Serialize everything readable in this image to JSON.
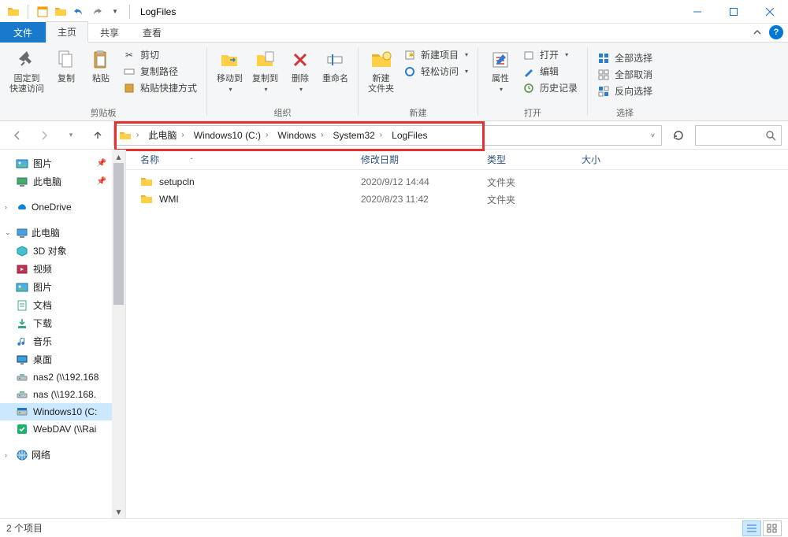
{
  "window": {
    "title": "LogFiles"
  },
  "tabs": {
    "file": "文件",
    "home": "主页",
    "share": "共享",
    "view": "查看"
  },
  "ribbon": {
    "pin": "固定到\n快速访问",
    "copy": "复制",
    "paste": "粘贴",
    "cut": "剪切",
    "copypath": "复制路径",
    "pasteshortcut": "粘贴快捷方式",
    "clipboard_group": "剪贴板",
    "moveto": "移动到",
    "copyto": "复制到",
    "delete": "删除",
    "rename": "重命名",
    "org_group": "组织",
    "newfolder": "新建\n文件夹",
    "newitem": "新建项目",
    "easyaccess": "轻松访问",
    "new_group": "新建",
    "properties": "属性",
    "open": "打开",
    "edit": "编辑",
    "history": "历史记录",
    "open_group": "打开",
    "selectall": "全部选择",
    "selectnone": "全部取消",
    "selectinvert": "反向选择",
    "select_group": "选择"
  },
  "breadcrumb": [
    "此电脑",
    "Windows10 (C:)",
    "Windows",
    "System32",
    "LogFiles"
  ],
  "columns": {
    "name": "名称",
    "date": "修改日期",
    "type": "类型",
    "size": "大小"
  },
  "rows": [
    {
      "name": "setupcln",
      "date": "2020/9/12 14:44",
      "type": "文件夹",
      "size": ""
    },
    {
      "name": "WMI",
      "date": "2020/8/23 11:42",
      "type": "文件夹",
      "size": ""
    }
  ],
  "nav": {
    "quick": [
      {
        "label": "图片",
        "icon": "picture",
        "pinned": true
      },
      {
        "label": "此电脑",
        "icon": "pc",
        "pinned": true
      }
    ],
    "onedrive": "OneDrive",
    "thispc": "此电脑",
    "pc_items": [
      {
        "label": "3D 对象",
        "icon": "cube"
      },
      {
        "label": "视频",
        "icon": "video"
      },
      {
        "label": "图片",
        "icon": "picture"
      },
      {
        "label": "文档",
        "icon": "doc"
      },
      {
        "label": "下载",
        "icon": "download"
      },
      {
        "label": "音乐",
        "icon": "music"
      },
      {
        "label": "桌面",
        "icon": "desktop"
      },
      {
        "label": "nas2 (\\\\192.168",
        "icon": "netdrive"
      },
      {
        "label": "nas (\\\\192.168.",
        "icon": "netdrive"
      },
      {
        "label": "Windows10 (C:",
        "icon": "drive",
        "selected": true
      },
      {
        "label": "WebDAV (\\\\Rai",
        "icon": "webdav"
      }
    ],
    "network": "网络"
  },
  "status": {
    "count": "2 个项目"
  }
}
